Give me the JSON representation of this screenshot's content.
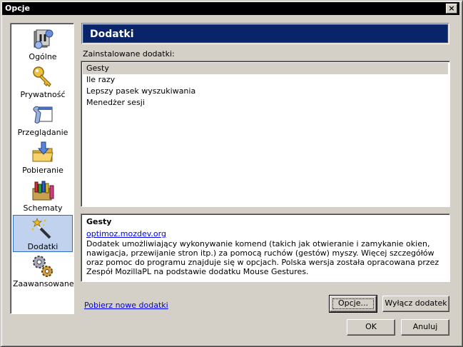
{
  "window": {
    "title": "Opcje",
    "close_label": "×"
  },
  "sidebar": {
    "items": [
      {
        "label": "Ogólne",
        "icon": "general-icon",
        "selected": false
      },
      {
        "label": "Prywatność",
        "icon": "privacy-key-icon",
        "selected": false
      },
      {
        "label": "Przeglądanie",
        "icon": "browsing-icon",
        "selected": false
      },
      {
        "label": "Pobieranie",
        "icon": "download-folder-icon",
        "selected": false
      },
      {
        "label": "Schematy",
        "icon": "themes-icon",
        "selected": false
      },
      {
        "label": "Dodatki",
        "icon": "addons-wand-icon",
        "selected": true
      },
      {
        "label": "Zaawansowane",
        "icon": "advanced-gears-icon",
        "selected": false
      }
    ]
  },
  "main": {
    "header": "Dodatki",
    "installed_label": "Zainstalowane dodatki:",
    "addons": [
      "Gesty",
      "Ile razy",
      "Lepszy pasek wyszukiwania",
      "Menedżer sesji"
    ],
    "selected_addon": "Gesty",
    "details": {
      "name": "Gesty",
      "url": "optimoz.mozdev.org",
      "description": "Dodatek umożliwiający wykonywanie komend (takich jak otwieranie i zamykanie okien, nawigacja, przewijanie stron itp.) za pomocą ruchów (gestów) myszy. Więcej szczegółów oraz pomoc do programu znajduje się w opcjach. Polska wersja została opracowana przez Zespół MozillaPL na podstawie dodatku Mouse Gestures."
    },
    "get_more_link": "Pobierz nowe dodatki",
    "options_button": "Opcje...",
    "disable_button": "Wyłącz dodatek"
  },
  "footer": {
    "ok_button": "OK",
    "cancel_button": "Anuluj"
  },
  "colors": {
    "header_bg": "#0a246a",
    "selection_bg": "#c1d2ee",
    "link": "#0000ee"
  }
}
